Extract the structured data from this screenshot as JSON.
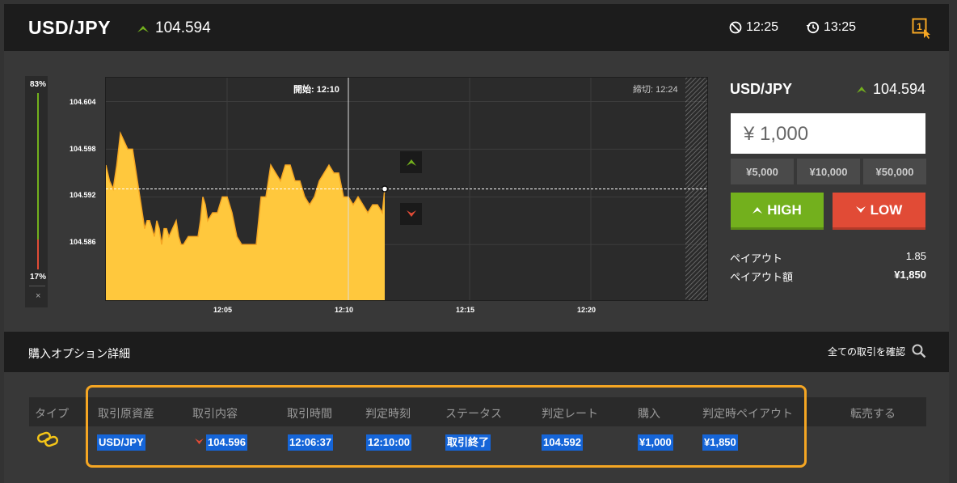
{
  "header": {
    "pair": "USD/JPY",
    "price": "104.594",
    "time_start": "12:25",
    "time_end": "13:25"
  },
  "gauge": {
    "high_pct": "83%",
    "low_pct": "17%",
    "close": "×"
  },
  "chart_data": {
    "type": "area",
    "title": "",
    "start_label": "開始: 12:10",
    "end_label": "締切: 12:24",
    "y_ticks": [
      "104.604",
      "104.598",
      "104.592",
      "104.586"
    ],
    "x_ticks": [
      "12:05",
      "12:10",
      "12:15",
      "12:20"
    ],
    "current_rate": 104.593,
    "x_minutes": [
      0,
      0.15,
      0.3,
      0.45,
      0.6,
      0.75,
      0.9,
      1.0,
      1.1,
      1.25,
      1.4,
      1.5,
      1.6,
      1.7,
      1.8,
      1.9,
      2.0,
      2.1,
      2.2,
      2.3,
      2.4,
      2.5,
      2.6,
      2.75,
      2.9,
      3.0,
      3.1,
      3.2,
      3.4,
      3.6,
      3.8,
      3.9,
      4.0,
      4.1,
      4.2,
      4.4,
      4.6,
      4.8,
      5.0,
      5.2,
      5.4,
      5.6,
      5.8,
      6.0,
      6.2,
      6.4,
      6.6,
      6.8,
      7.0,
      7.2,
      7.4,
      7.6,
      7.8,
      8.0,
      8.2,
      8.4,
      8.6,
      8.8,
      9.0,
      9.2,
      9.4,
      9.6,
      9.8,
      10.0,
      10.2,
      10.4,
      10.6,
      10.8,
      11.0,
      11.2,
      11.4,
      11.5
    ],
    "values": [
      104.596,
      104.594,
      104.593,
      104.596,
      104.6,
      104.599,
      104.598,
      104.598,
      104.598,
      104.595,
      104.592,
      104.59,
      104.588,
      104.589,
      104.589,
      104.588,
      104.587,
      104.589,
      104.588,
      104.586,
      104.588,
      104.588,
      104.587,
      104.588,
      104.589,
      104.587,
      104.586,
      104.586,
      104.587,
      104.587,
      104.587,
      104.589,
      104.592,
      104.591,
      104.589,
      104.59,
      104.59,
      104.592,
      104.592,
      104.59,
      104.587,
      104.586,
      104.586,
      104.586,
      104.586,
      104.592,
      104.592,
      104.596,
      104.595,
      104.594,
      104.596,
      104.596,
      104.594,
      104.594,
      104.592,
      104.591,
      104.592,
      104.594,
      104.595,
      104.596,
      104.595,
      104.595,
      104.592,
      104.592,
      104.591,
      104.592,
      104.591,
      104.59,
      104.591,
      104.591,
      104.59,
      104.593
    ],
    "x_range": [
      0,
      24.9
    ],
    "ylim": [
      104.579,
      104.607
    ],
    "grid": true,
    "colors": {
      "area": "#ffc83d",
      "line": "#f5a623",
      "grid": "#3d3d3d"
    }
  },
  "trade_panel": {
    "pair": "USD/JPY",
    "price": "104.594",
    "amount": "¥ 1,000",
    "quick_amounts": [
      "¥5,000",
      "¥10,000",
      "¥50,000"
    ],
    "high_label": "HIGH",
    "low_label": "LOW",
    "payout_label": "ペイアウト",
    "payout_value": "1.85",
    "payout_amount_label": "ペイアウト額",
    "payout_amount_value": "¥1,850"
  },
  "details": {
    "title": "購入オプション詳細",
    "view_all": "全ての取引を確認",
    "columns": [
      "タイプ",
      "取引原資産",
      "取引内容",
      "取引時間",
      "判定時刻",
      "ステータス",
      "判定レート",
      "購入",
      "判定時ペイアウト",
      "転売する"
    ],
    "row": {
      "asset": "USD/JPY",
      "content": "104.596",
      "trade_time": "12:06:37",
      "judge_time": "12:10:00",
      "status": "取引終了",
      "judge_rate": "104.592",
      "purchase": "¥1,000",
      "payout": "¥1,850"
    }
  },
  "colors": {
    "high": "#73b01d",
    "low": "#e14b36",
    "accent": "#f5a623",
    "selection": "#1565d8"
  }
}
